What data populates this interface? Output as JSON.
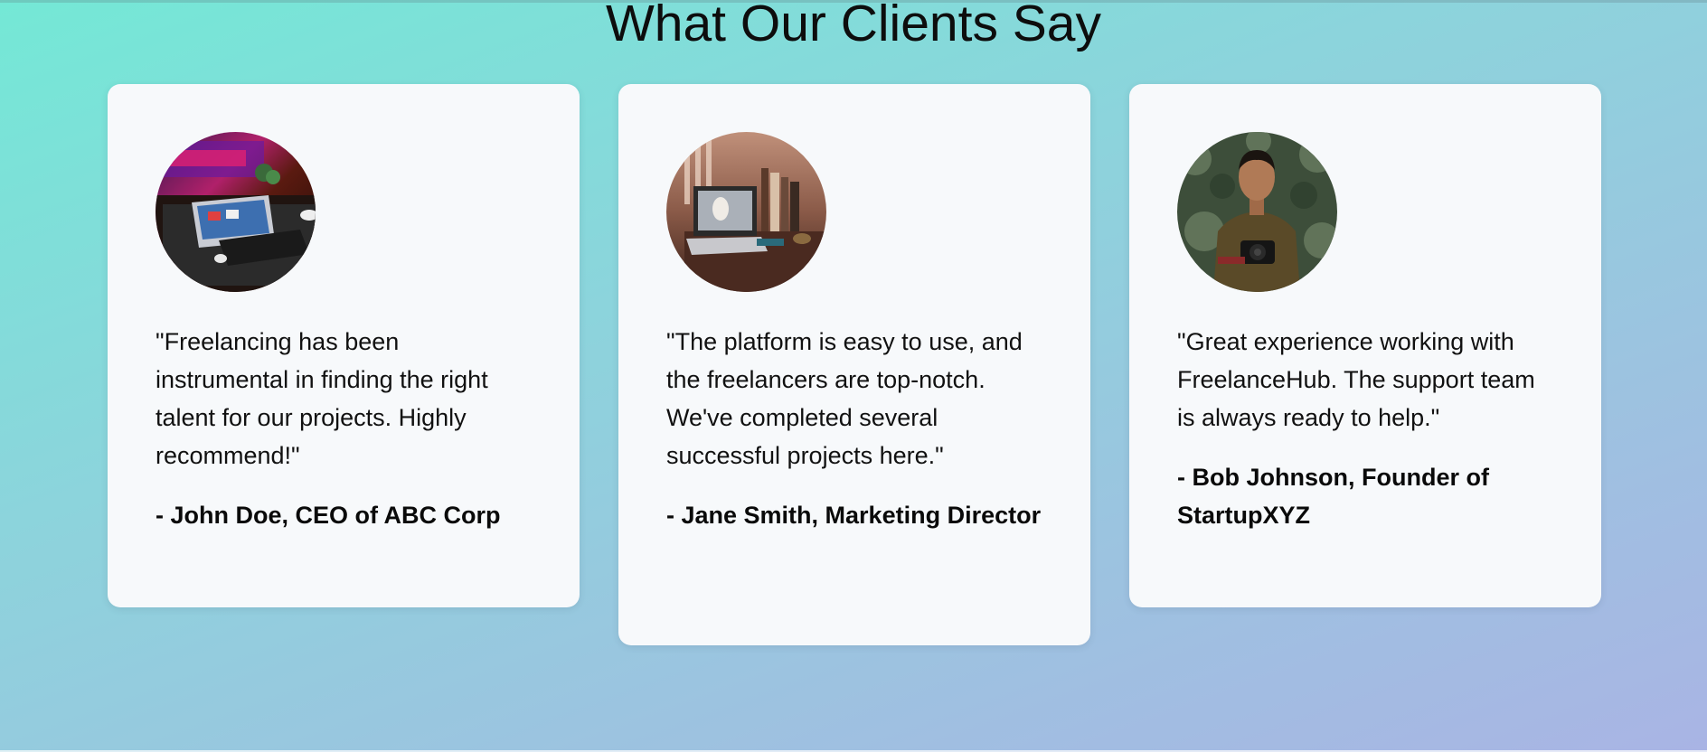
{
  "section": {
    "title": "What Our Clients Say"
  },
  "testimonials": [
    {
      "quote": "\"Freelancing has been instrumental in finding the right talent for our projects. Highly recommend!\"",
      "author": "- John Doe, CEO of ABC Corp",
      "avatar_icon": "laptop-desk-photo"
    },
    {
      "quote": "\"The platform is easy to use, and the freelancers are top-notch. We've completed several successful projects here.\"",
      "author": "- Jane Smith, Marketing Director",
      "avatar_icon": "workspace-photo"
    },
    {
      "quote": "\"Great experience working with FreelanceHub. The support team is always ready to help.\"",
      "author": "- Bob Johnson, Founder of StartupXYZ",
      "avatar_icon": "photographer-portrait-photo"
    }
  ],
  "colors": {
    "card_background": "#f7f9fb",
    "gradient_start": "#74e8d6",
    "gradient_end": "#a9b4e4"
  }
}
